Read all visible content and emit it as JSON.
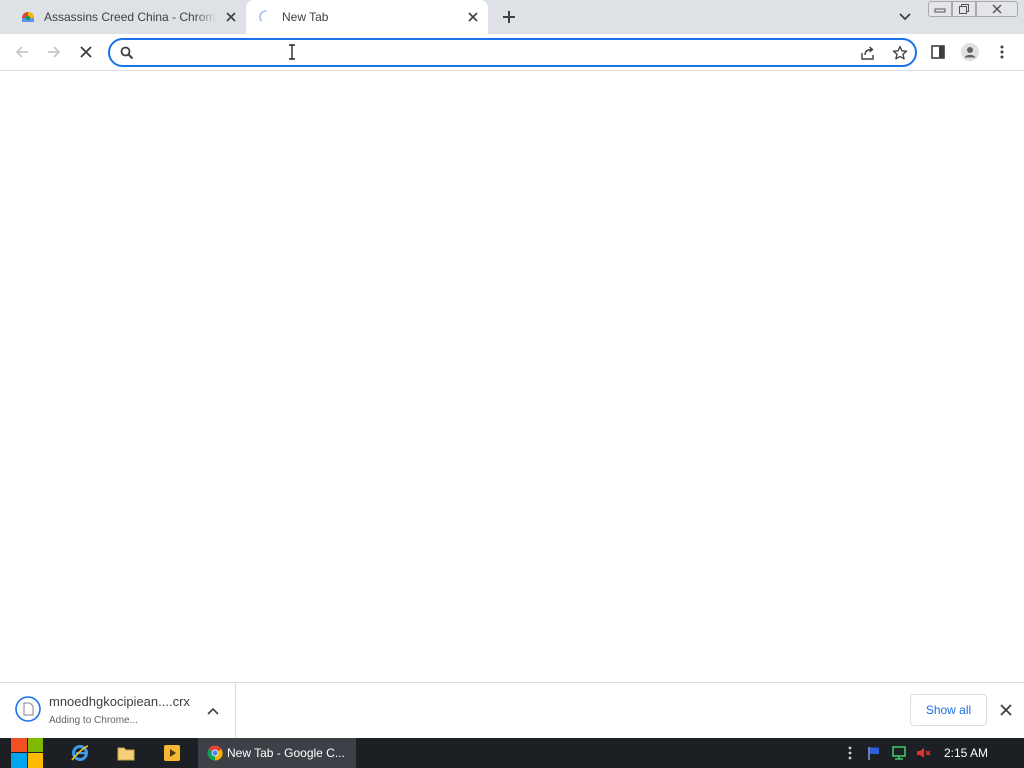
{
  "colors": {
    "accent": "#1a73e8",
    "tabstrip_bg": "#dee1e6",
    "taskbar_bg": "#1c1f24",
    "taskbar_active_bg": "#3d4147"
  },
  "tabs": [
    {
      "title": "Assassins Creed China - Chrome",
      "icon": "webstore-favicon-icon",
      "active": false
    },
    {
      "title": "New Tab",
      "icon": "loading-spinner-icon",
      "active": true
    }
  ],
  "toolbar": {
    "omnibox": {
      "value": "",
      "placeholder": ""
    }
  },
  "download": {
    "filename": "mnoedhgkocipiean....crx",
    "status": "Adding to Chrome...",
    "show_all_label": "Show all"
  },
  "taskbar": {
    "active_window_label": "New Tab - Google C...",
    "clock": "2:15 AM"
  }
}
